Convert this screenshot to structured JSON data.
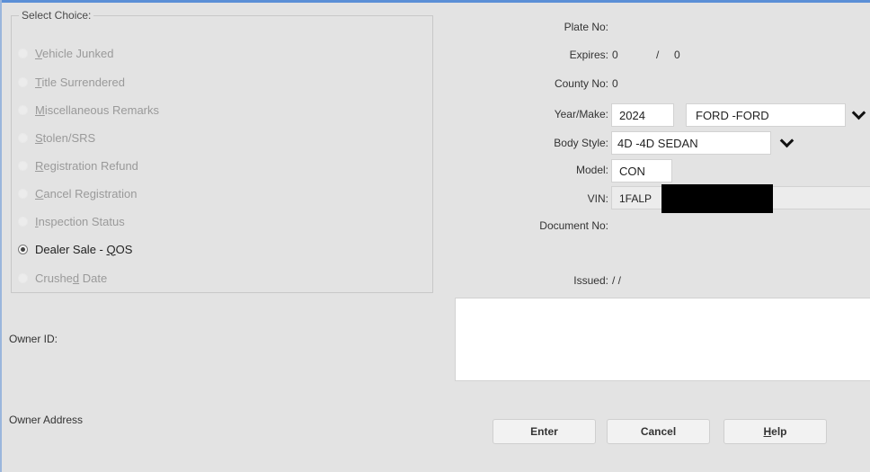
{
  "select_choice": {
    "legend": "Select Choice:",
    "options": [
      {
        "pre": "",
        "ul": "V",
        "post": "ehicle Junked",
        "checked": false
      },
      {
        "pre": "",
        "ul": "T",
        "post": "itle Surrendered",
        "checked": false
      },
      {
        "pre": "",
        "ul": "M",
        "post": "iscellaneous Remarks",
        "checked": false
      },
      {
        "pre": "",
        "ul": "S",
        "post": "tolen/SRS",
        "checked": false
      },
      {
        "pre": "",
        "ul": "R",
        "post": "egistration Refund",
        "checked": false
      },
      {
        "pre": "",
        "ul": "C",
        "post": "ancel Registration",
        "checked": false
      },
      {
        "pre": "",
        "ul": "I",
        "post": "nspection Status",
        "checked": false
      },
      {
        "pre": "Dealer Sale - ",
        "ul": "Q",
        "post": "OS",
        "checked": true
      },
      {
        "pre": "Crushe",
        "ul": "d",
        "post": " Date",
        "checked": false
      }
    ]
  },
  "vehicle": {
    "plate_label": "Plate No:",
    "expires_label": "Expires:",
    "expires_month": "0",
    "expires_sep": "/",
    "expires_year": "0",
    "county_label": "County No:",
    "county_value": "0",
    "year_make_label": "Year/Make:",
    "year_value": "2024",
    "make_value": "FORD -FORD",
    "body_style_label": "Body Style:",
    "body_style_value": "4D -4D SEDAN",
    "model_label": "Model:",
    "model_value": "CON",
    "vin_label": "VIN:",
    "vin_value": "1FALP",
    "document_label": "Document No:",
    "issued_label": "Issued:",
    "issued_value": "/ /"
  },
  "owner": {
    "id_label": "Owner ID:",
    "address_label": "Owner Address"
  },
  "buttons": {
    "enter": "Enter",
    "cancel": "Cancel",
    "help_ul": "H",
    "help_rest": "elp"
  },
  "icons": {
    "dropdown": "chevron-down-icon"
  }
}
